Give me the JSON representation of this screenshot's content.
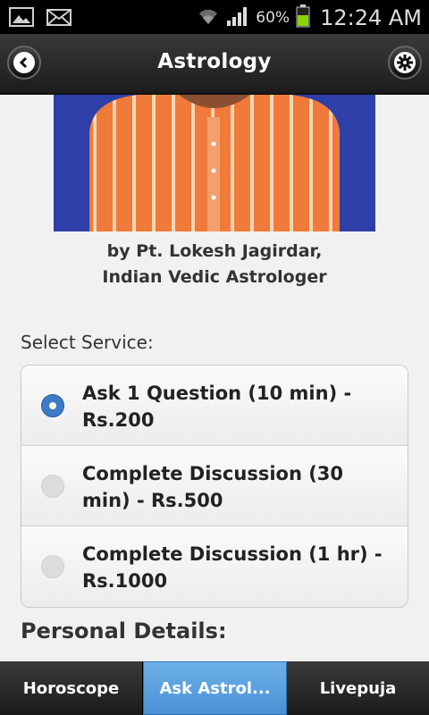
{
  "status": {
    "battery_pct": "60%",
    "time": "12:24 AM"
  },
  "header": {
    "title": "Astrology"
  },
  "photo": {
    "description": ""
  },
  "caption": {
    "line1": "by Pt. Lokesh Jagirdar,",
    "line2": "Indian Vedic Astrologer"
  },
  "form": {
    "select_label": "Select Service:",
    "options": [
      {
        "label": "Ask 1 Question (10 min) - Rs.200",
        "selected": true
      },
      {
        "label": "Complete Discussion (30 min) - Rs.500",
        "selected": false
      },
      {
        "label": "Complete Discussion (1 hr) - Rs.1000",
        "selected": false
      }
    ],
    "personal_label": "Personal Details:"
  },
  "tabs": [
    {
      "label": "Horoscope",
      "active": false
    },
    {
      "label": "Ask Astrol...",
      "active": true
    },
    {
      "label": "Livepuja",
      "active": false
    }
  ]
}
